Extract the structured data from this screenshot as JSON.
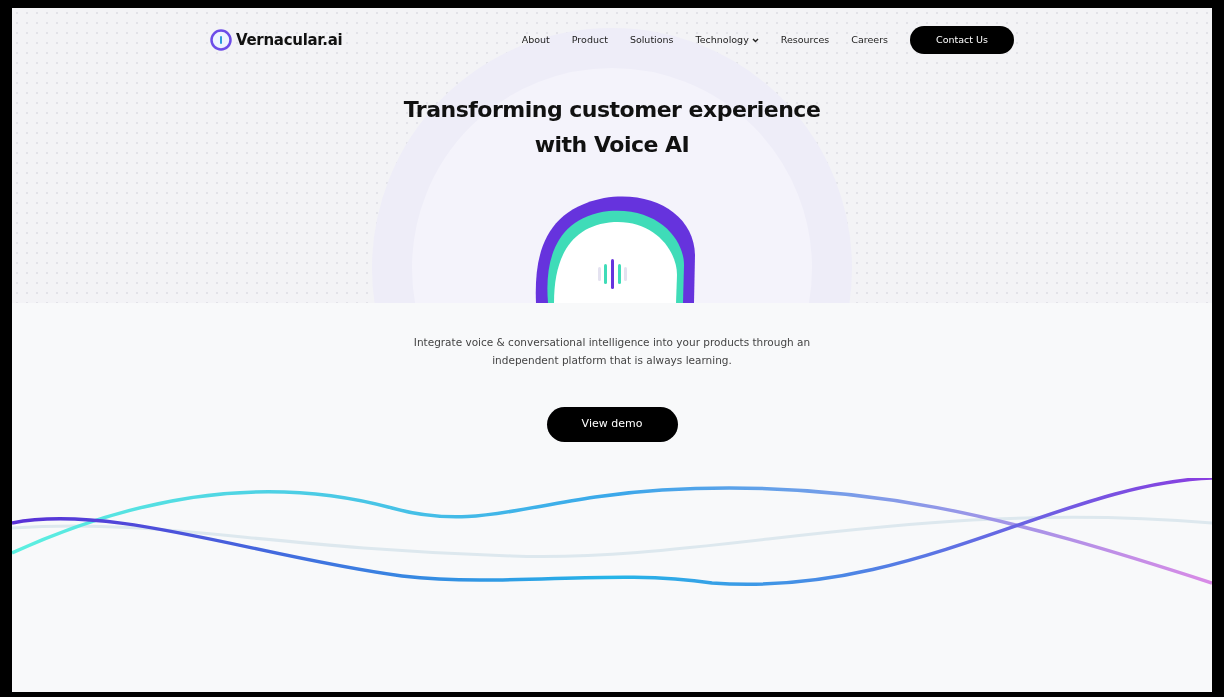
{
  "header": {
    "logo_text": "Vernacular.ai",
    "nav": [
      {
        "label": "About",
        "has_menu": false
      },
      {
        "label": "Product",
        "has_menu": false
      },
      {
        "label": "Solutions",
        "has_menu": false
      },
      {
        "label": "Technology",
        "has_menu": true
      },
      {
        "label": "Resources",
        "has_menu": false
      },
      {
        "label": "Careers",
        "has_menu": false
      }
    ],
    "cta": "Contact Us"
  },
  "hero": {
    "title_lines": [
      "Transforming customer experience",
      "with Voice AI"
    ],
    "description": "Integrate voice & conversational intelligence into your products through an independent platform that is always learning.",
    "button": "View demo"
  }
}
